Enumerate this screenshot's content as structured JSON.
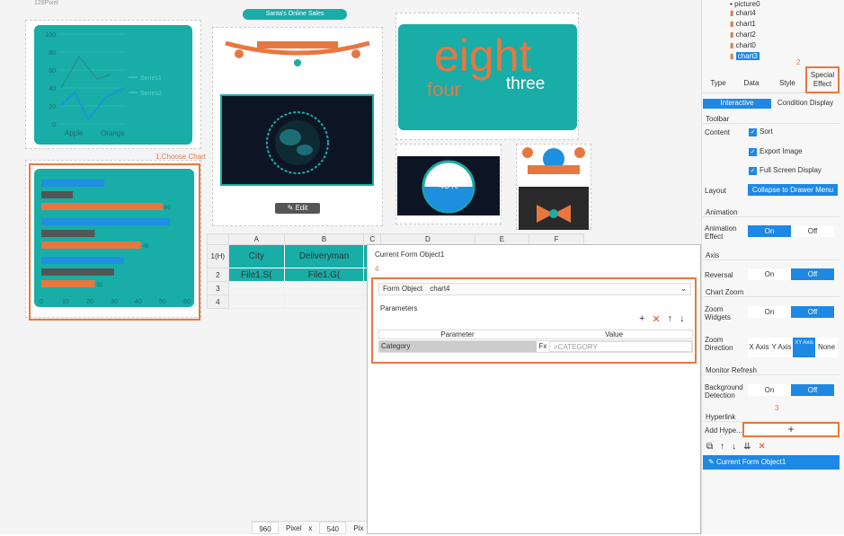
{
  "canvas": {
    "top_label": "128Pixel",
    "banner": "Santa's Online Sales",
    "choose_chart_label": "1.Choose Chart",
    "edit_label": "Edit",
    "big_text": {
      "a": "eight",
      "b": "four",
      "c": "three"
    },
    "gauge_value": "45%",
    "status": {
      "width": "960",
      "unit1": "Pixel",
      "x": "x",
      "height": "540",
      "unit2": "Pix"
    }
  },
  "line_chart": {
    "type": "line",
    "categories": [
      "Apple",
      "Orange"
    ],
    "yticks": [
      "100",
      "80",
      "60",
      "40",
      "20",
      "0"
    ],
    "ylim": [
      0,
      100
    ],
    "series": [
      {
        "name": "Series1"
      },
      {
        "name": "Series2"
      }
    ]
  },
  "chart_data": {
    "type": "bar",
    "xticks": [
      "0",
      "10",
      "20",
      "30",
      "40",
      "50",
      "60"
    ],
    "xlim": [
      0,
      60
    ],
    "groups": [
      {
        "values": [
          26,
          13,
          50
        ],
        "labels": [
          "",
          "",
          "60"
        ]
      },
      {
        "values": [
          53,
          22,
          41
        ],
        "labels": [
          "",
          "",
          "46"
        ]
      },
      {
        "values": [
          34,
          30,
          22
        ],
        "labels": [
          "",
          "",
          "30"
        ]
      }
    ],
    "colors": [
      "#1f8fe0",
      "#555555",
      "#e8773f"
    ]
  },
  "sheet": {
    "col_headers": [
      "A",
      "B",
      "C",
      "D",
      "E",
      "F"
    ],
    "corner": "1(H)",
    "rows": [
      {
        "num": "2",
        "cells": [
          "File1.S(",
          "File1.G(",
          "",
          ""
        ]
      },
      {
        "num": "3",
        "cells": [
          "",
          "",
          "",
          ""
        ]
      },
      {
        "num": "4",
        "cells": [
          "",
          "",
          "",
          ""
        ]
      }
    ],
    "header_row": [
      "City",
      "Deliveryman",
      "C",
      ""
    ]
  },
  "dialog": {
    "title": "Current Form Object1",
    "step": "4",
    "form_object_label": "Form Object",
    "form_object_value": "chart4",
    "parameters_label": "Parameters",
    "col_param": "Parameter",
    "col_value": "Value",
    "param_row": {
      "name": "Category",
      "fx": "Fx",
      "value": "=CATEGORY"
    }
  },
  "tree": {
    "items": [
      "picture0",
      "chart4",
      "chart1",
      "chart2",
      "chart0",
      "chart3"
    ],
    "step": "2"
  },
  "props": {
    "tabs": [
      "Type",
      "Data",
      "Style",
      "Special Effect"
    ],
    "subtabs": [
      "Interactive",
      "Condition Display"
    ],
    "toolbar": "Toolbar",
    "content": "Content",
    "checks": [
      "Sort",
      "Export Image",
      "Full Screen Display"
    ],
    "layout_label": "Layout",
    "layout_value": "Collapse to Drawer Menu",
    "animation": "Animation",
    "animation_effect": "Animation Effect",
    "on": "On",
    "off": "Off",
    "axis": "Axis",
    "reversal": "Reversal",
    "chart_zoom": "Chart Zoom",
    "zoom_widgets": "Zoom Widgets",
    "zoom_direction": "Zoom Direction",
    "zoom_dirs": [
      "X Axis",
      "Y Axis",
      "XY Axis",
      "None"
    ],
    "monitor_refresh": "Monitor Refresh",
    "bg_detection": "Background Detection",
    "step3": "3",
    "hyperlink": "Hyperlink",
    "add_hyper": "Add Hype...",
    "add_btn": "+",
    "link_item": "Current Form Object1"
  }
}
